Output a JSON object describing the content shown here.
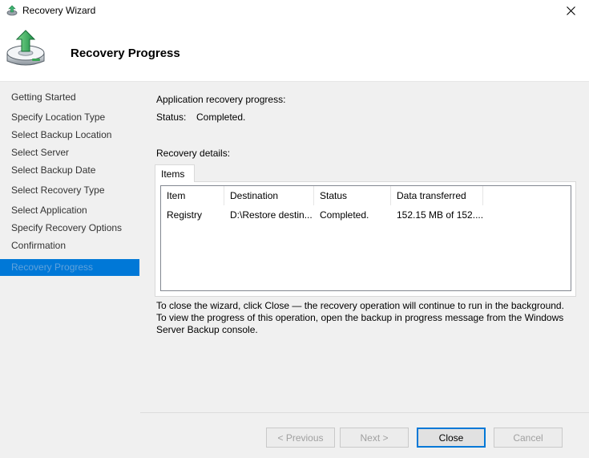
{
  "window": {
    "title": "Recovery Wizard",
    "icons": {
      "app": "recovery-wizard-icon",
      "close": "close-icon",
      "hero": "disk-restore-icon"
    }
  },
  "header": {
    "title": "Recovery Progress"
  },
  "sidebar": {
    "steps": [
      {
        "label": "Getting Started",
        "active": false
      },
      {
        "label": "Specify Location Type",
        "active": false
      },
      {
        "label": "Select Backup Location",
        "active": false
      },
      {
        "label": "Select Server",
        "active": false
      },
      {
        "label": "Select Backup Date",
        "active": false
      },
      {
        "label": "Select Recovery Type",
        "active": false
      },
      {
        "label": "Select Application",
        "active": false
      },
      {
        "label": "Specify Recovery Options",
        "active": false
      },
      {
        "label": "Confirmation",
        "active": false
      },
      {
        "label": "Recovery Progress",
        "active": true
      }
    ]
  },
  "main": {
    "progress_heading": "Application recovery progress:",
    "status_label": "Status:",
    "status_value": "Completed.",
    "details_heading": "Recovery details:",
    "tab_label": "Items",
    "table": {
      "columns": [
        "Item",
        "Destination",
        "Status",
        "Data transferred"
      ],
      "rows": [
        [
          "Registry",
          "D:\\Restore destin...",
          "Completed.",
          "152.15 MB of 152...."
        ]
      ]
    },
    "info_line_1": "To close the wizard, click Close — the recovery operation will continue to run in the background.",
    "info_line_2": "To view the progress of this operation, open the backup in progress message from the Windows Server Backup console."
  },
  "buttons": {
    "previous": "< Previous",
    "next": "Next >",
    "close": "Close",
    "cancel": "Cancel"
  },
  "colors": {
    "accent": "#0078d7",
    "sidebar_bg": "#f0f0f0",
    "arrow_green": "#3cb371"
  }
}
